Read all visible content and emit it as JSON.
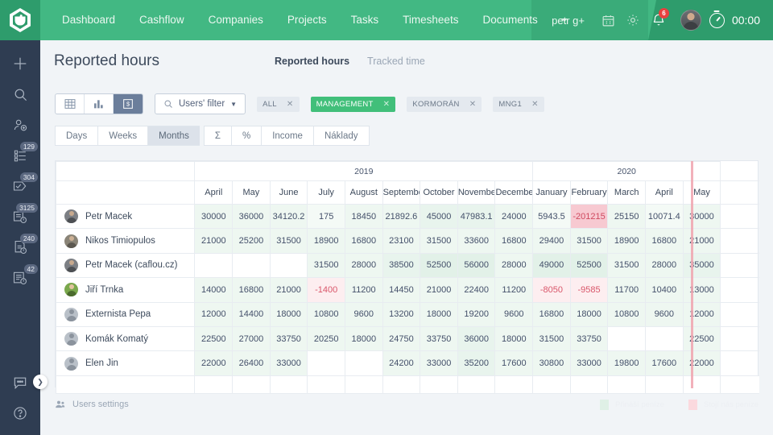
{
  "topbar": {
    "logo_icon": "caflou-cup-logo",
    "nav": [
      {
        "label": "Dashboard"
      },
      {
        "label": "Cashflow"
      },
      {
        "label": "Companies"
      },
      {
        "label": "Projects"
      },
      {
        "label": "Tasks"
      },
      {
        "label": "Timesheets"
      },
      {
        "label": "Documents"
      }
    ],
    "nav_more_icon": "chevron-down-icon",
    "user_menu": "petr g+",
    "user_menu_icon": "chevron-down-icon",
    "calendar_icon": "calendar-icon",
    "settings_icon": "gear-icon",
    "bell_icon": "bell-icon",
    "bell_badge": "6",
    "avatar_icon": "user-avatar",
    "timer_icon": "stopwatch-icon",
    "timer_value": "00:00"
  },
  "sidebar": {
    "items": [
      {
        "name": "add-icon",
        "badge": ""
      },
      {
        "name": "search-icon",
        "badge": ""
      },
      {
        "name": "add-user-icon",
        "badge": ""
      },
      {
        "name": "project-list-icon",
        "badge": "129"
      },
      {
        "name": "task-check-icon",
        "badge": "304"
      },
      {
        "name": "invoice-clock-icon",
        "badge": "3125"
      },
      {
        "name": "document-clock-icon",
        "badge": "240"
      },
      {
        "name": "report-clock-icon",
        "badge": "42"
      }
    ],
    "bottom_items": [
      {
        "name": "chat-bubble-icon"
      },
      {
        "name": "help-question-icon"
      }
    ],
    "toggle_icon": "chevron-right-icon"
  },
  "header": {
    "title": "Reported hours",
    "tabs": [
      {
        "label": "Reported hours",
        "active": true
      },
      {
        "label": "Tracked time",
        "active": false
      }
    ]
  },
  "toolbar": {
    "views": [
      {
        "name": "table-view-icon",
        "active": false
      },
      {
        "name": "chart-view-icon",
        "active": false
      },
      {
        "name": "money-report-view-icon",
        "active": true
      }
    ],
    "filter": {
      "icon": "search-icon",
      "label": "Users' filter",
      "caret_icon": "caret-down-icon"
    },
    "tags": [
      {
        "label": "ALL",
        "active": false,
        "close_icon": "close-icon"
      },
      {
        "label": "MANAGEMENT",
        "active": true,
        "close_icon": "close-icon"
      },
      {
        "label": "KORMORÁN",
        "active": false,
        "close_icon": "close-icon"
      },
      {
        "label": "MNG1",
        "active": false,
        "close_icon": "close-icon"
      }
    ],
    "segments_group_1": [
      {
        "label": "Days",
        "active": false
      },
      {
        "label": "Weeks",
        "active": false
      },
      {
        "label": "Months",
        "active": true
      }
    ],
    "segments_group_2": [
      {
        "label": "Σ",
        "active": false
      },
      {
        "label": "%",
        "active": false
      },
      {
        "label": "Income",
        "active": false
      },
      {
        "label": "Náklady",
        "active": false
      }
    ]
  },
  "table": {
    "year_groups": [
      {
        "label": "",
        "span": 1
      },
      {
        "label": "2019",
        "span": 9
      },
      {
        "label": "2020",
        "span": 5
      },
      {
        "label": "",
        "span": 1
      }
    ],
    "months": [
      "April",
      "May",
      "June",
      "July",
      "August",
      "September",
      "October",
      "November",
      "December",
      "January",
      "February",
      "March",
      "April",
      "May"
    ],
    "rows": [
      {
        "name": "Petr Macek",
        "avatar": "p1",
        "cells": [
          {
            "v": "30000",
            "s": "g2"
          },
          {
            "v": "36000",
            "s": "g2"
          },
          {
            "v": "34120.2",
            "s": "g2"
          },
          {
            "v": "175",
            "s": "g1"
          },
          {
            "v": "18450",
            "s": "g2"
          },
          {
            "v": "21892.6",
            "s": "g2"
          },
          {
            "v": "45000",
            "s": "g3"
          },
          {
            "v": "47983.1",
            "s": "g3"
          },
          {
            "v": "24000",
            "s": "g2"
          },
          {
            "v": "5943.5",
            "s": "g1"
          },
          {
            "v": "-201215",
            "s": "r2"
          },
          {
            "v": "25150",
            "s": "g2"
          },
          {
            "v": "10071.4",
            "s": "g1"
          },
          {
            "v": "30000",
            "s": "g2"
          }
        ]
      },
      {
        "name": "Nikos Timiopulos",
        "avatar": "p2",
        "cells": [
          {
            "v": "21000",
            "s": "g2"
          },
          {
            "v": "25200",
            "s": "g2"
          },
          {
            "v": "31500",
            "s": "g2"
          },
          {
            "v": "18900",
            "s": "g2"
          },
          {
            "v": "16800",
            "s": "g2"
          },
          {
            "v": "23100",
            "s": "g2"
          },
          {
            "v": "31500",
            "s": "g2"
          },
          {
            "v": "33600",
            "s": "g2"
          },
          {
            "v": "16800",
            "s": "g2"
          },
          {
            "v": "29400",
            "s": "g2"
          },
          {
            "v": "31500",
            "s": "g2"
          },
          {
            "v": "18900",
            "s": "g2"
          },
          {
            "v": "16800",
            "s": "g2"
          },
          {
            "v": "21000",
            "s": "g2"
          }
        ]
      },
      {
        "name": "Petr Macek (caflou.cz)",
        "avatar": "p3",
        "cells": [
          {
            "v": "",
            "s": "g0"
          },
          {
            "v": "",
            "s": "g0"
          },
          {
            "v": "",
            "s": "g0"
          },
          {
            "v": "31500",
            "s": "g2"
          },
          {
            "v": "28000",
            "s": "g2"
          },
          {
            "v": "38500",
            "s": "g3"
          },
          {
            "v": "52500",
            "s": "g4"
          },
          {
            "v": "56000",
            "s": "g4"
          },
          {
            "v": "28000",
            "s": "g2"
          },
          {
            "v": "49000",
            "s": "g4"
          },
          {
            "v": "52500",
            "s": "g4"
          },
          {
            "v": "31500",
            "s": "g2"
          },
          {
            "v": "28000",
            "s": "g2"
          },
          {
            "v": "35000",
            "s": "g3"
          }
        ]
      },
      {
        "name": "Jiří Trnka",
        "avatar": "p4",
        "cells": [
          {
            "v": "14000",
            "s": "g2"
          },
          {
            "v": "16800",
            "s": "g2"
          },
          {
            "v": "21000",
            "s": "g2"
          },
          {
            "v": "-1400",
            "s": "r1"
          },
          {
            "v": "11200",
            "s": "g2"
          },
          {
            "v": "14450",
            "s": "g2"
          },
          {
            "v": "21000",
            "s": "g2"
          },
          {
            "v": "22400",
            "s": "g2"
          },
          {
            "v": "11200",
            "s": "g2"
          },
          {
            "v": "-8050",
            "s": "r1"
          },
          {
            "v": "-9585",
            "s": "r1"
          },
          {
            "v": "11700",
            "s": "g2"
          },
          {
            "v": "10400",
            "s": "g2"
          },
          {
            "v": "13000",
            "s": "g2"
          }
        ]
      },
      {
        "name": "Externista Pepa",
        "avatar": "p0",
        "cells": [
          {
            "v": "12000",
            "s": "g2"
          },
          {
            "v": "14400",
            "s": "g2"
          },
          {
            "v": "18000",
            "s": "g2"
          },
          {
            "v": "10800",
            "s": "g2"
          },
          {
            "v": "9600",
            "s": "g2"
          },
          {
            "v": "13200",
            "s": "g2"
          },
          {
            "v": "18000",
            "s": "g2"
          },
          {
            "v": "19200",
            "s": "g2"
          },
          {
            "v": "9600",
            "s": "g2"
          },
          {
            "v": "16800",
            "s": "g2"
          },
          {
            "v": "18000",
            "s": "g2"
          },
          {
            "v": "10800",
            "s": "g2"
          },
          {
            "v": "9600",
            "s": "g2"
          },
          {
            "v": "12000",
            "s": "g2"
          }
        ]
      },
      {
        "name": "Komák Komatý",
        "avatar": "p0",
        "cells": [
          {
            "v": "22500",
            "s": "g2"
          },
          {
            "v": "27000",
            "s": "g2"
          },
          {
            "v": "33750",
            "s": "g2"
          },
          {
            "v": "20250",
            "s": "g2"
          },
          {
            "v": "18000",
            "s": "g2"
          },
          {
            "v": "24750",
            "s": "g2"
          },
          {
            "v": "33750",
            "s": "g2"
          },
          {
            "v": "36000",
            "s": "g3"
          },
          {
            "v": "18000",
            "s": "g2"
          },
          {
            "v": "31500",
            "s": "g2"
          },
          {
            "v": "33750",
            "s": "g2"
          },
          {
            "v": "",
            "s": "g0"
          },
          {
            "v": "",
            "s": "g0"
          },
          {
            "v": "22500",
            "s": "g2"
          }
        ]
      },
      {
        "name": "Elen Jin",
        "avatar": "p0",
        "cells": [
          {
            "v": "22000",
            "s": "g2"
          },
          {
            "v": "26400",
            "s": "g2"
          },
          {
            "v": "33000",
            "s": "g2"
          },
          {
            "v": "",
            "s": "g0"
          },
          {
            "v": "",
            "s": "g0"
          },
          {
            "v": "24200",
            "s": "g2"
          },
          {
            "v": "33000",
            "s": "g2"
          },
          {
            "v": "35200",
            "s": "g3"
          },
          {
            "v": "17600",
            "s": "g2"
          },
          {
            "v": "30800",
            "s": "g2"
          },
          {
            "v": "33000",
            "s": "g2"
          },
          {
            "v": "19800",
            "s": "g2"
          },
          {
            "v": "17600",
            "s": "g2"
          },
          {
            "v": "22000",
            "s": "g2"
          }
        ]
      }
    ]
  },
  "footer": {
    "users_settings_icon": "users-icon",
    "users_settings_label": "Users settings",
    "legend": [
      {
        "label": "Přináší peníze",
        "swatch": "sw-green"
      },
      {
        "label": "Stojí nás peníze",
        "swatch": "sw-red"
      }
    ]
  },
  "colors": {
    "brand_green": "#42b883",
    "brand_green_dark": "#2e9c6c",
    "sidebar": "#2f3d52",
    "tag_active": "#41bf7a",
    "positive_cell": "#e8f4ed",
    "negative_cell": "#f7c9d1",
    "negative_text": "#cf4a60",
    "today_line": "#f0a3ae"
  }
}
